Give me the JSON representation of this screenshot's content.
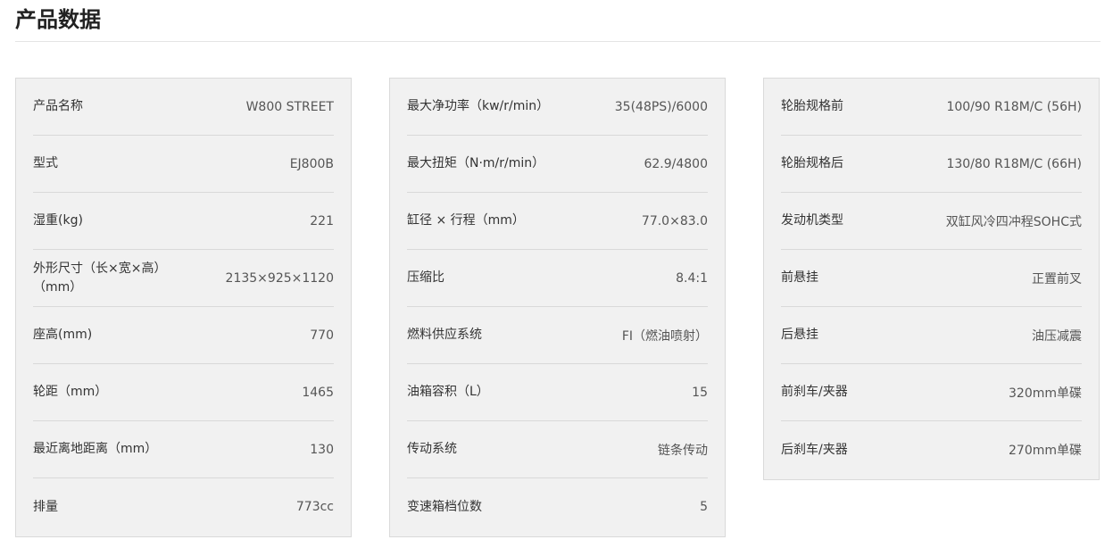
{
  "page_title": "产品数据",
  "panels": [
    {
      "rows": [
        {
          "label": "产品名称",
          "value": "W800 STREET"
        },
        {
          "label": "型式",
          "value": "EJ800B"
        },
        {
          "label": "湿重(kg)",
          "value": "221"
        },
        {
          "label": "外形尺寸（长×宽×高）（mm）",
          "value": "2135×925×1120"
        },
        {
          "label": "座高(mm)",
          "value": "770"
        },
        {
          "label": "轮距（mm）",
          "value": "1465"
        },
        {
          "label": "最近离地距离（mm）",
          "value": "130"
        },
        {
          "label": "排量",
          "value": "773cc"
        }
      ]
    },
    {
      "rows": [
        {
          "label": "最大净功率（kw/r/min）",
          "value": "35(48PS)/6000"
        },
        {
          "label": "最大扭矩（N·m/r/min）",
          "value": "62.9/4800"
        },
        {
          "label": "缸径 × 行程（mm）",
          "value": "77.0×83.0"
        },
        {
          "label": "压缩比",
          "value": "8.4:1"
        },
        {
          "label": "燃料供应系统",
          "value": "FI（燃油喷射）"
        },
        {
          "label": "油箱容积（L）",
          "value": "15"
        },
        {
          "label": "传动系统",
          "value": "链条传动"
        },
        {
          "label": "变速箱档位数",
          "value": "5"
        }
      ]
    },
    {
      "rows": [
        {
          "label": "轮胎规格前",
          "value": "100/90 R18M/C (56H)"
        },
        {
          "label": "轮胎规格后",
          "value": "130/80 R18M/C (66H)"
        },
        {
          "label": "发动机类型",
          "value": "双缸风冷四冲程SOHC式"
        },
        {
          "label": "前悬挂",
          "value": "正置前叉"
        },
        {
          "label": "后悬挂",
          "value": "油压减震"
        },
        {
          "label": "前刹车/夹器",
          "value": "320mm单碟"
        },
        {
          "label": "后刹车/夹器",
          "value": "270mm单碟"
        }
      ]
    }
  ]
}
